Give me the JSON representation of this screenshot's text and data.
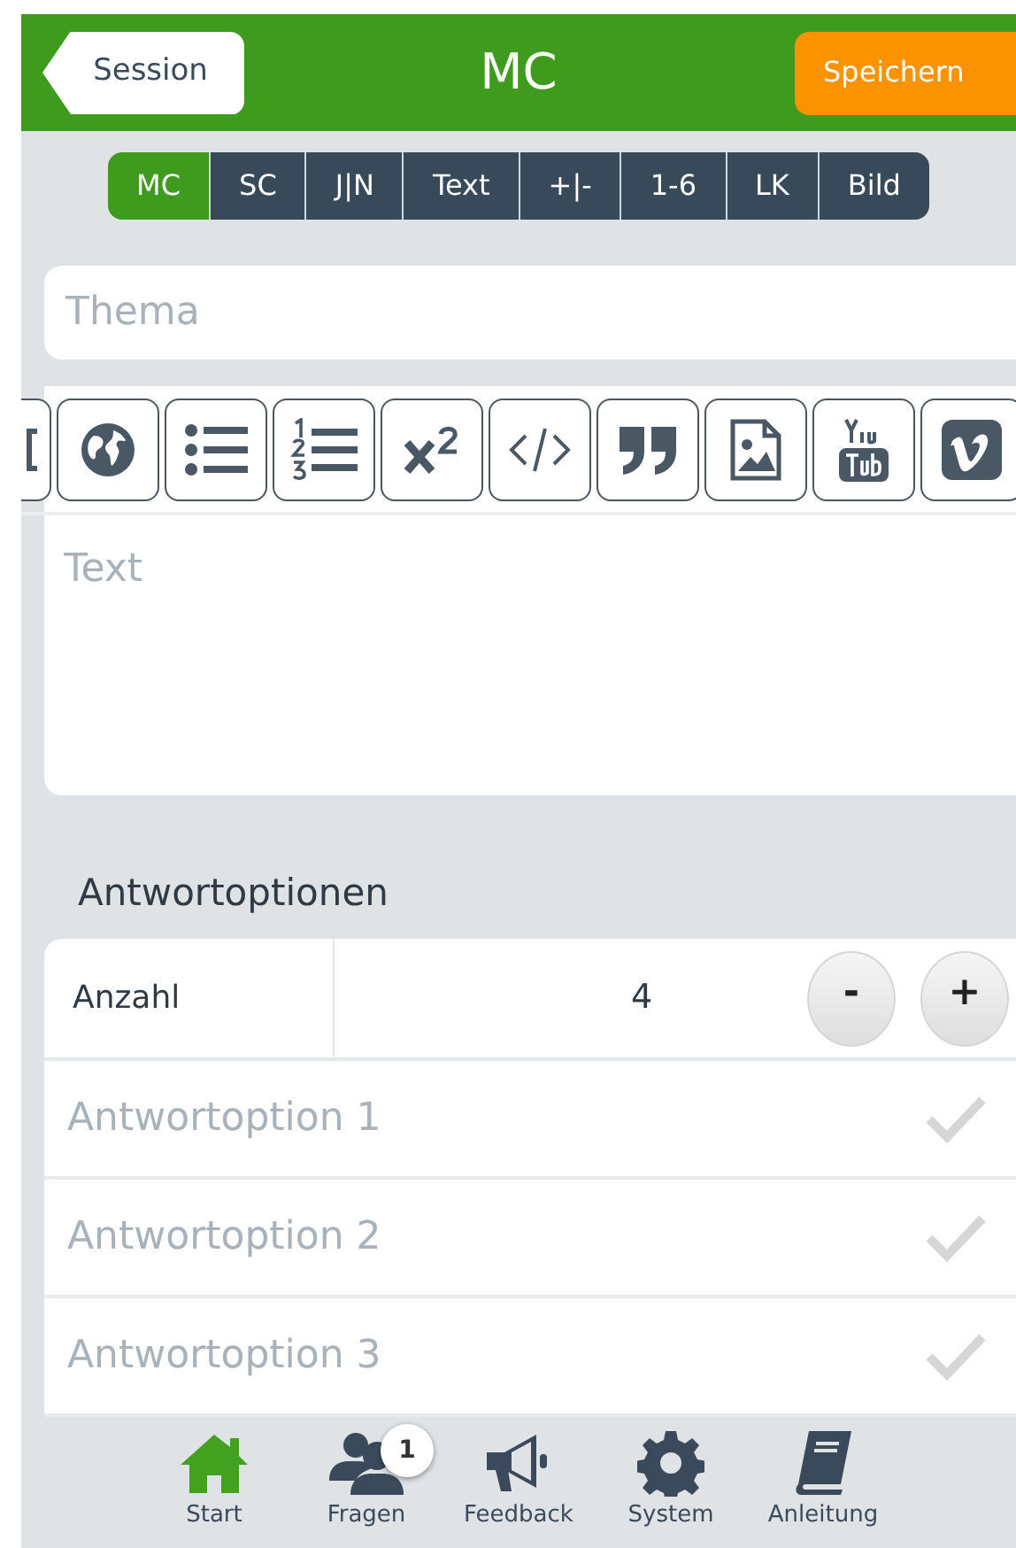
{
  "header": {
    "back": "Session",
    "title": "MC",
    "save": "Speichern"
  },
  "question_types": [
    {
      "label": "MC",
      "selected": true
    },
    {
      "label": "SC",
      "selected": false
    },
    {
      "label": "J|N",
      "selected": false
    },
    {
      "label": "Text",
      "selected": false
    },
    {
      "label": "+|-",
      "selected": false
    },
    {
      "label": "1-6",
      "selected": false
    },
    {
      "label": "LK",
      "selected": false
    },
    {
      "label": "Bild",
      "selected": false
    }
  ],
  "subject": {
    "placeholder": "Thema"
  },
  "toolbar": [
    {
      "kind": "bracket"
    },
    {
      "kind": "globe"
    },
    {
      "kind": "bullets"
    },
    {
      "kind": "numbers"
    },
    {
      "kind": "superscript"
    },
    {
      "kind": "code"
    },
    {
      "kind": "quote"
    },
    {
      "kind": "image"
    },
    {
      "kind": "youtube"
    },
    {
      "kind": "vimeo"
    }
  ],
  "text": {
    "placeholder": "Text"
  },
  "answers": {
    "heading": "Antwortoptionen",
    "count_label": "Anzahl",
    "count": "4",
    "minus": "-",
    "plus": "+",
    "options": [
      {
        "placeholder": "Antwortoption 1",
        "checked": false
      },
      {
        "placeholder": "Antwortoption 2",
        "checked": false
      },
      {
        "placeholder": "Antwortoption 3",
        "checked": false
      }
    ]
  },
  "nav": [
    {
      "label": "Start",
      "kind": "home",
      "selected": true
    },
    {
      "label": "Fragen",
      "kind": "users",
      "selected": false,
      "badge": "1"
    },
    {
      "label": "Feedback",
      "kind": "megaphone",
      "selected": false
    },
    {
      "label": "System",
      "kind": "gear",
      "selected": false
    },
    {
      "label": "Anleitung",
      "kind": "book",
      "selected": false
    }
  ]
}
